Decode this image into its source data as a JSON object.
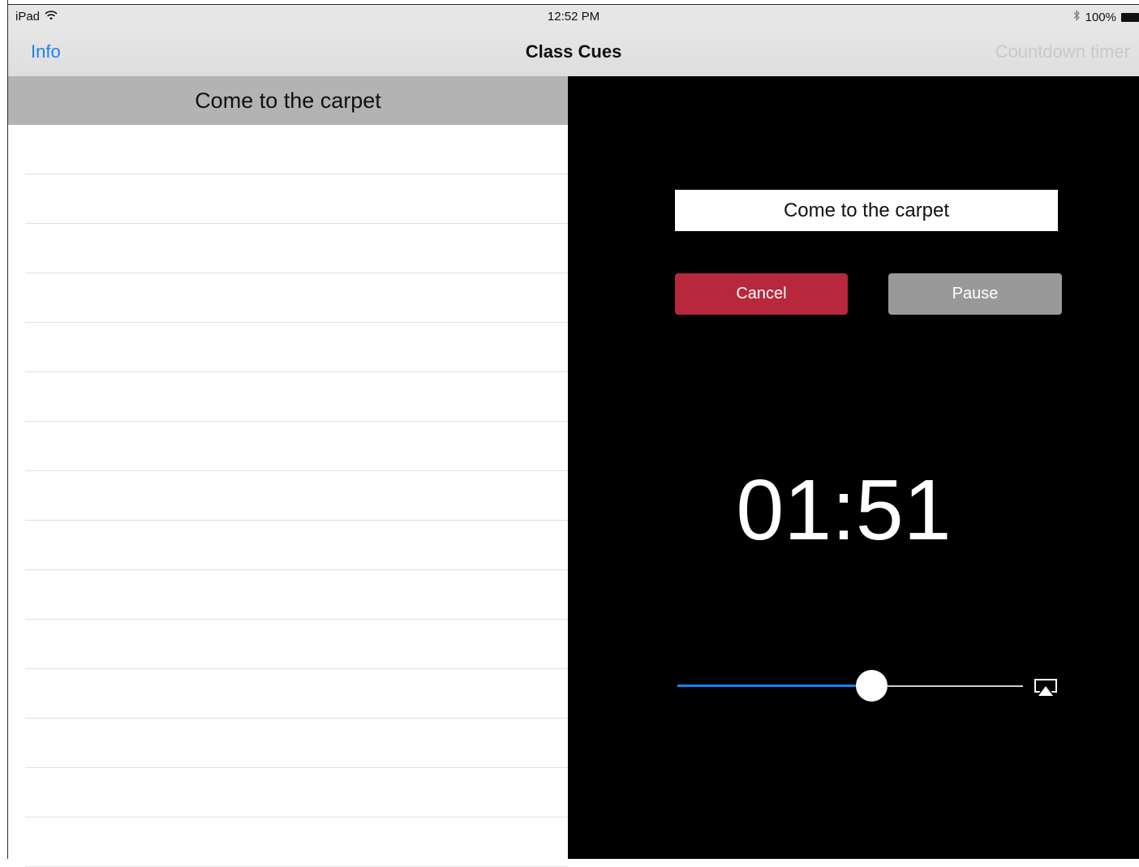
{
  "status_bar": {
    "carrier": "iPad",
    "time": "12:52 PM",
    "battery": "100%",
    "icons": [
      "wifi-icon",
      "bluetooth-icon",
      "battery-icon"
    ]
  },
  "nav_bar": {
    "left_label": "Info",
    "title": "Class Cues",
    "right_label": "Countdown timer"
  },
  "left_pane": {
    "header": "Come to the carpet",
    "row_count_visible": 15
  },
  "timer_panel": {
    "cue_text": "Come to the carpet",
    "cancel_label": "Cancel",
    "pause_label": "Pause",
    "time_remaining": "01:51",
    "volume_level": 0.56
  },
  "colors": {
    "accent": "#1a82f7",
    "cancel": "#b7283c",
    "pause": "#999999",
    "left_header_bg": "#b3b3b3",
    "panel_bg": "#000000"
  }
}
